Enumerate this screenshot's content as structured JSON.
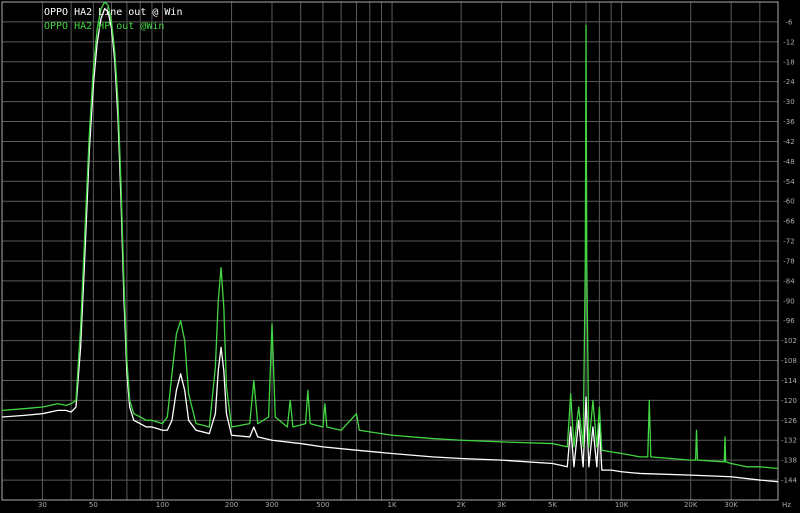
{
  "chart_data": {
    "type": "line",
    "title": "",
    "xlabel": "",
    "x_unit": "Hz",
    "ylabel": "",
    "x_scale": "log",
    "xlim": [
      20,
      48000
    ],
    "ylim": [
      -150,
      0
    ],
    "grid": true,
    "legend_position": "top-left",
    "background_color": "#000000",
    "grid_color": "#5a5a5a",
    "axis_color": "#aaaaaa",
    "x_ticks": [
      {
        "value": 30,
        "label": "30"
      },
      {
        "value": 50,
        "label": "50"
      },
      {
        "value": 100,
        "label": "100"
      },
      {
        "value": 200,
        "label": "200"
      },
      {
        "value": 300,
        "label": "300"
      },
      {
        "value": 500,
        "label": "500"
      },
      {
        "value": 1000,
        "label": "1K"
      },
      {
        "value": 2000,
        "label": "2K"
      },
      {
        "value": 3000,
        "label": "3K"
      },
      {
        "value": 5000,
        "label": "5K"
      },
      {
        "value": 10000,
        "label": "10K"
      },
      {
        "value": 20000,
        "label": "20K"
      },
      {
        "value": 30000,
        "label": "30K"
      }
    ],
    "y_ticks": [
      -6,
      -12,
      -18,
      -24,
      -30,
      -36,
      -42,
      -48,
      -54,
      -60,
      -66,
      -72,
      -78,
      -84,
      -90,
      -96,
      -102,
      -108,
      -114,
      -120,
      -126,
      -132,
      -138,
      -144
    ],
    "series": [
      {
        "name": "OPPO HA2 Line out @ Win",
        "color": "#ffffff",
        "points": [
          [
            20,
            -125
          ],
          [
            25,
            -124.5
          ],
          [
            30,
            -124
          ],
          [
            35,
            -123
          ],
          [
            38,
            -123
          ],
          [
            40,
            -123.5
          ],
          [
            42,
            -122
          ],
          [
            44,
            -104
          ],
          [
            46,
            -75
          ],
          [
            48,
            -45
          ],
          [
            50,
            -25
          ],
          [
            52,
            -12
          ],
          [
            54,
            -5
          ],
          [
            56,
            -2
          ],
          [
            58,
            -3
          ],
          [
            60,
            -8
          ],
          [
            62,
            -18
          ],
          [
            64,
            -35
          ],
          [
            66,
            -60
          ],
          [
            68,
            -90
          ],
          [
            70,
            -112
          ],
          [
            72,
            -122
          ],
          [
            75,
            -126
          ],
          [
            80,
            -127
          ],
          [
            85,
            -128
          ],
          [
            90,
            -128
          ],
          [
            95,
            -128.5
          ],
          [
            100,
            -129
          ],
          [
            105,
            -129
          ],
          [
            110,
            -126
          ],
          [
            115,
            -117
          ],
          [
            120,
            -112
          ],
          [
            125,
            -117
          ],
          [
            130,
            -126
          ],
          [
            140,
            -129
          ],
          [
            150,
            -129.5
          ],
          [
            160,
            -130
          ],
          [
            170,
            -124
          ],
          [
            175,
            -111
          ],
          [
            180,
            -104
          ],
          [
            185,
            -111
          ],
          [
            190,
            -124
          ],
          [
            200,
            -130.5
          ],
          [
            240,
            -131
          ],
          [
            250,
            -128
          ],
          [
            260,
            -131
          ],
          [
            300,
            -132
          ],
          [
            400,
            -133
          ],
          [
            500,
            -134
          ],
          [
            700,
            -135
          ],
          [
            1000,
            -136
          ],
          [
            1500,
            -137
          ],
          [
            2000,
            -137.5
          ],
          [
            3000,
            -138
          ],
          [
            5000,
            -139
          ],
          [
            5800,
            -140
          ],
          [
            6000,
            -128
          ],
          [
            6200,
            -140
          ],
          [
            6500,
            -126
          ],
          [
            6800,
            -140
          ],
          [
            7000,
            -119
          ],
          [
            7200,
            -140
          ],
          [
            7500,
            -128
          ],
          [
            7800,
            -140
          ],
          [
            8000,
            -127
          ],
          [
            8200,
            -141
          ],
          [
            9000,
            -141
          ],
          [
            10000,
            -141.5
          ],
          [
            12000,
            -142
          ],
          [
            20000,
            -142.5
          ],
          [
            30000,
            -143
          ],
          [
            40000,
            -144
          ],
          [
            48000,
            -144.5
          ]
        ]
      },
      {
        "name": "OPPO HA2 HP out @Win",
        "color": "#42d642",
        "points": [
          [
            20,
            -123
          ],
          [
            25,
            -122.5
          ],
          [
            30,
            -122
          ],
          [
            35,
            -121
          ],
          [
            38,
            -121.5
          ],
          [
            40,
            -121
          ],
          [
            42,
            -120
          ],
          [
            44,
            -98
          ],
          [
            46,
            -68
          ],
          [
            48,
            -40
          ],
          [
            50,
            -20
          ],
          [
            52,
            -8
          ],
          [
            54,
            -2
          ],
          [
            56,
            0
          ],
          [
            58,
            -1
          ],
          [
            60,
            -6
          ],
          [
            62,
            -15
          ],
          [
            64,
            -30
          ],
          [
            66,
            -55
          ],
          [
            68,
            -85
          ],
          [
            70,
            -108
          ],
          [
            72,
            -120
          ],
          [
            75,
            -124
          ],
          [
            80,
            -125
          ],
          [
            85,
            -126
          ],
          [
            90,
            -126
          ],
          [
            95,
            -126.5
          ],
          [
            100,
            -127
          ],
          [
            105,
            -125
          ],
          [
            110,
            -112
          ],
          [
            115,
            -100
          ],
          [
            120,
            -96
          ],
          [
            125,
            -102
          ],
          [
            130,
            -118
          ],
          [
            140,
            -127
          ],
          [
            150,
            -127.5
          ],
          [
            160,
            -128
          ],
          [
            170,
            -110
          ],
          [
            175,
            -90
          ],
          [
            180,
            -80
          ],
          [
            185,
            -92
          ],
          [
            190,
            -116
          ],
          [
            200,
            -128
          ],
          [
            240,
            -127
          ],
          [
            250,
            -114
          ],
          [
            260,
            -127
          ],
          [
            290,
            -125
          ],
          [
            300,
            -97
          ],
          [
            310,
            -125
          ],
          [
            350,
            -128
          ],
          [
            360,
            -120
          ],
          [
            370,
            -128
          ],
          [
            420,
            -127
          ],
          [
            430,
            -117
          ],
          [
            440,
            -127
          ],
          [
            500,
            -128
          ],
          [
            510,
            -121
          ],
          [
            520,
            -128
          ],
          [
            600,
            -129
          ],
          [
            700,
            -124
          ],
          [
            720,
            -129
          ],
          [
            1000,
            -130.5
          ],
          [
            1500,
            -131.5
          ],
          [
            2000,
            -132
          ],
          [
            3000,
            -132.5
          ],
          [
            5000,
            -133
          ],
          [
            5800,
            -134
          ],
          [
            6000,
            -118
          ],
          [
            6200,
            -134
          ],
          [
            6500,
            -122
          ],
          [
            6800,
            -134
          ],
          [
            6950,
            -78
          ],
          [
            7000,
            -7
          ],
          [
            7050,
            -78
          ],
          [
            7200,
            -134
          ],
          [
            7500,
            -120
          ],
          [
            7800,
            -134
          ],
          [
            8000,
            -122
          ],
          [
            8200,
            -135
          ],
          [
            9000,
            -135.5
          ],
          [
            10000,
            -136
          ],
          [
            12000,
            -137
          ],
          [
            13000,
            -137
          ],
          [
            13200,
            -120
          ],
          [
            13400,
            -137
          ],
          [
            20000,
            -138
          ],
          [
            21000,
            -138
          ],
          [
            21200,
            -129
          ],
          [
            21400,
            -138
          ],
          [
            28000,
            -138.5
          ],
          [
            28200,
            -131
          ],
          [
            28400,
            -138.5
          ],
          [
            30000,
            -139
          ],
          [
            35000,
            -140
          ],
          [
            40000,
            -140
          ],
          [
            48000,
            -140.5
          ]
        ]
      }
    ]
  }
}
